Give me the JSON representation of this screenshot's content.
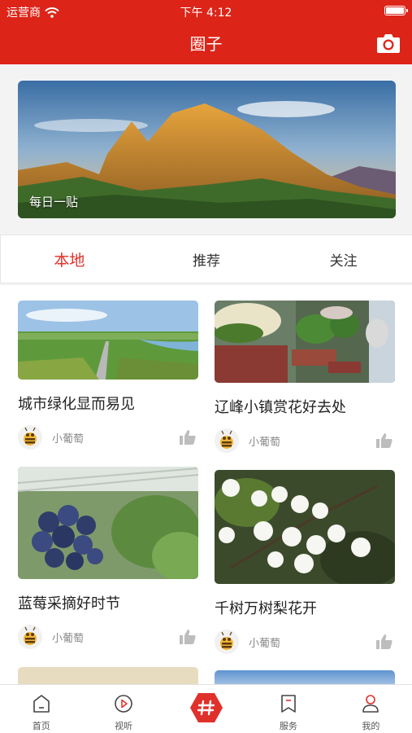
{
  "status_bar": {
    "carrier": "运营商",
    "time": "下午 4:12"
  },
  "header": {
    "title": "圈子"
  },
  "banner": {
    "caption": "每日一贴"
  },
  "tabs": [
    {
      "label": "本地",
      "active": true
    },
    {
      "label": "推荐",
      "active": false
    },
    {
      "label": "关注",
      "active": false
    }
  ],
  "posts": [
    {
      "title": "城市绿化显而易见",
      "author": "小葡萄"
    },
    {
      "title": "辽峰小镇赏花好去处",
      "author": "小葡萄"
    },
    {
      "title": "蓝莓采摘好时节",
      "author": "小葡萄"
    },
    {
      "title": "千树万树梨花开",
      "author": "小葡萄"
    }
  ],
  "tabbar": [
    {
      "label": "首页",
      "icon": "home-icon"
    },
    {
      "label": "视听",
      "icon": "play-icon"
    },
    {
      "label": "",
      "icon": "hashtag-icon"
    },
    {
      "label": "服务",
      "icon": "bookmark-icon"
    },
    {
      "label": "我的",
      "icon": "profile-icon"
    }
  ],
  "colors": {
    "brand_red": "#dc2418",
    "active_tab": "#e0302a"
  }
}
